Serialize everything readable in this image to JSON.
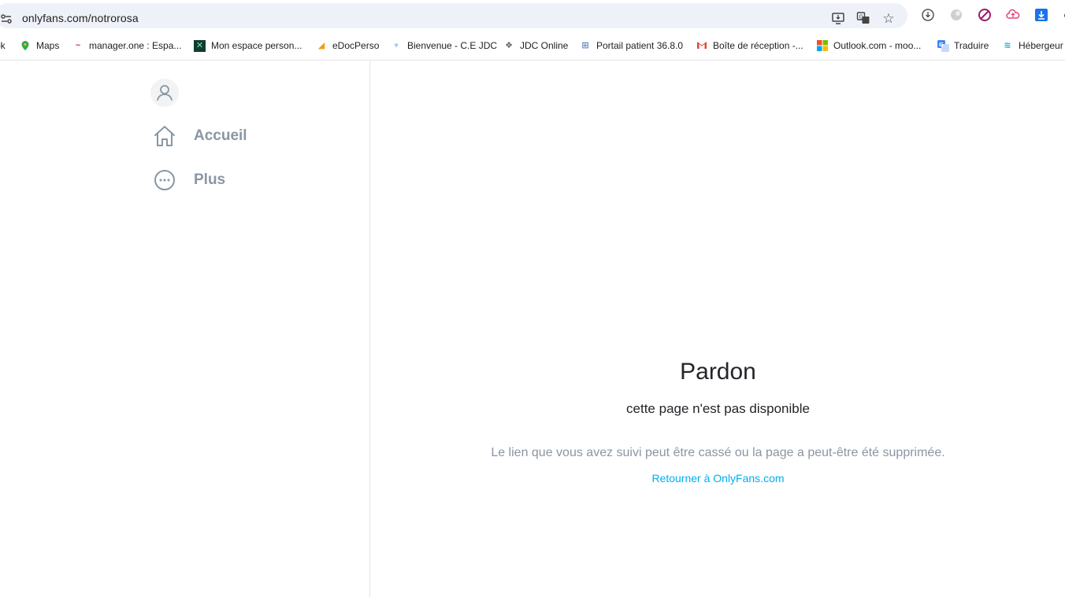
{
  "browser": {
    "url": "onlyfans.com/notrorosa",
    "bookmarks": [
      {
        "label": "ok",
        "icon": "generic-icon"
      },
      {
        "label": "Maps",
        "icon": "maps-pin-icon"
      },
      {
        "label": "manager.one : Espa...",
        "icon": "manager-icon"
      },
      {
        "label": "Mon espace person...",
        "icon": "espace-icon"
      },
      {
        "label": "eDocPerso",
        "icon": "edoc-icon"
      },
      {
        "label": "Bienvenue - C.E JDC",
        "icon": "ce-icon"
      },
      {
        "label": "JDC Online",
        "icon": "jdc-icon"
      },
      {
        "label": "Portail patient 36.8.0",
        "icon": "portail-icon"
      },
      {
        "label": "Boîte de réception -...",
        "icon": "gmail-icon"
      },
      {
        "label": "Outlook.com - moo...",
        "icon": "microsoft-icon"
      },
      {
        "label": "Traduire",
        "icon": "translate-icon"
      },
      {
        "label": "Hébergeur",
        "icon": "hebergeur-icon"
      }
    ]
  },
  "sidebar": {
    "items": [
      {
        "label": "Accueil",
        "icon": "home-icon"
      },
      {
        "label": "Plus",
        "icon": "more-circle-icon"
      }
    ]
  },
  "error": {
    "title": "Pardon",
    "subtitle": "cette page n'est pas disponible",
    "description": "Le lien que vous avez suivi peut être cassé ou la page a peut-être été supprimée.",
    "link_label": "Retourner à OnlyFans.com"
  },
  "colors": {
    "accent": "#00aff0",
    "muted": "#8a96a3",
    "text": "#242529"
  }
}
